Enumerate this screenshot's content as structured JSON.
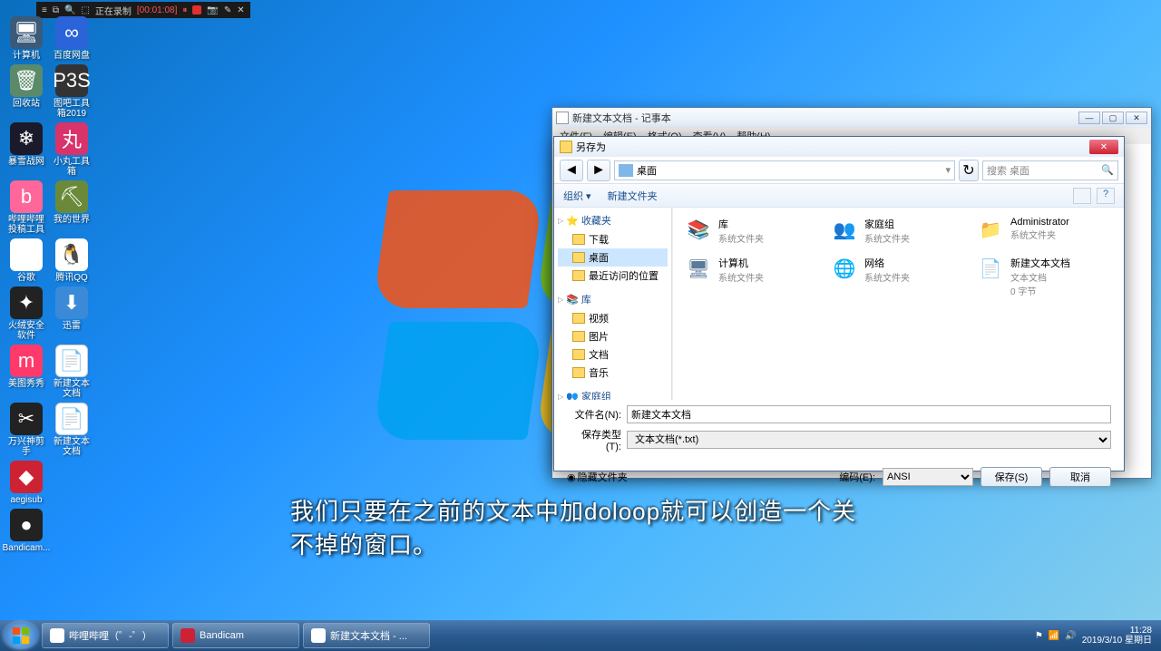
{
  "recording": {
    "status": "正在录制",
    "time": "[00:01:08]"
  },
  "desktop_icons": [
    [
      {
        "n": "计算机",
        "c": "ic-computer",
        "g": "🖥"
      },
      {
        "n": "百度网盘",
        "c": "ic-baidu",
        "g": "∞"
      }
    ],
    [
      {
        "n": "回收站",
        "c": "ic-recycle",
        "g": "🗑"
      },
      {
        "n": "图吧工具箱2019",
        "c": "ic-p3s",
        "g": "P3S"
      }
    ],
    [
      {
        "n": "暴雪战网",
        "c": "ic-bz",
        "g": "❄"
      },
      {
        "n": "小丸工具箱",
        "c": "ic-wan",
        "g": "丸"
      }
    ],
    [
      {
        "n": "哔哩哔哩投稿工具",
        "c": "ic-bili",
        "g": "b"
      },
      {
        "n": "我的世界",
        "c": "ic-mc",
        "g": "⛏"
      }
    ],
    [
      {
        "n": "谷歌",
        "c": "ic-chrome",
        "g": "◉"
      },
      {
        "n": "腾讯QQ",
        "c": "ic-qq",
        "g": "🐧"
      }
    ],
    [
      {
        "n": "火绒安全软件",
        "c": "ic-huoqiu",
        "g": "✦"
      },
      {
        "n": "迅雷",
        "c": "ic-xunlei",
        "g": "⬇"
      }
    ],
    [
      {
        "n": "美图秀秀",
        "c": "ic-meitu",
        "g": "m"
      },
      {
        "n": "新建文本文档",
        "c": "ic-txt",
        "g": "📄"
      }
    ],
    [
      {
        "n": "万兴神剪手",
        "c": "ic-wx",
        "g": "✂"
      },
      {
        "n": "新建文本文档",
        "c": "ic-txt2",
        "g": "📄"
      }
    ],
    [
      {
        "n": "aegisub",
        "c": "ic-aegi",
        "g": "◆"
      }
    ],
    [
      {
        "n": "Bandicam...",
        "c": "ic-bandi",
        "g": "●"
      }
    ]
  ],
  "notepad": {
    "title": "新建文本文档 - 记事本",
    "menu": [
      "文件(F)",
      "编辑(E)",
      "格式(O)",
      "查看(V)",
      "帮助(H)"
    ]
  },
  "save_dialog": {
    "title": "另存为",
    "crumb": "桌面",
    "search_placeholder": "搜索 桌面",
    "toolbar": {
      "organize": "组织 ▾",
      "newfolder": "新建文件夹"
    },
    "tree": {
      "fav": {
        "hdr": "收藏夹",
        "items": [
          "下载",
          "桌面",
          "最近访问的位置"
        ]
      },
      "lib": {
        "hdr": "库",
        "items": [
          "视频",
          "图片",
          "文档",
          "音乐"
        ]
      },
      "home": {
        "hdr": "家庭组"
      }
    },
    "files": [
      {
        "n": "库",
        "d": "系统文件夹",
        "ic": "📚",
        "col": "#e8a838"
      },
      {
        "n": "家庭组",
        "d": "系统文件夹",
        "ic": "👥",
        "col": "#3a9a4a"
      },
      {
        "n": "Administrator",
        "d": "系统文件夹",
        "ic": "📁",
        "col": "#e8a838"
      },
      {
        "n": "计算机",
        "d": "系统文件夹",
        "ic": "🖥",
        "col": "#5a7a9a"
      },
      {
        "n": "网络",
        "d": "系统文件夹",
        "ic": "🌐",
        "col": "#3a6ad8"
      },
      {
        "n": "新建文本文档",
        "d": "文本文档",
        "d2": "0 字节",
        "ic": "📄",
        "col": "#fff"
      }
    ],
    "filename_label": "文件名(N):",
    "filename_value": "新建文本文档",
    "filetype_label": "保存类型(T):",
    "filetype_value": "文本文档(*.txt)",
    "hide_folders": "隐藏文件夹",
    "encoding_label": "编码(E):",
    "encoding_value": "ANSI",
    "save_btn": "保存(S)",
    "cancel_btn": "取消"
  },
  "subtitle": "我们只要在之前的文本中加doloop就可以创造一个关不掉的窗口。",
  "taskbar": {
    "tasks": [
      {
        "n": "哔哩哔哩（゜-゜）",
        "c": "#fff"
      },
      {
        "n": "Bandicam",
        "c": "#c23"
      },
      {
        "n": "新建文本文档 - ...",
        "c": "#fff"
      }
    ],
    "time": "11:28",
    "date": "2019/3/10 星期日"
  }
}
